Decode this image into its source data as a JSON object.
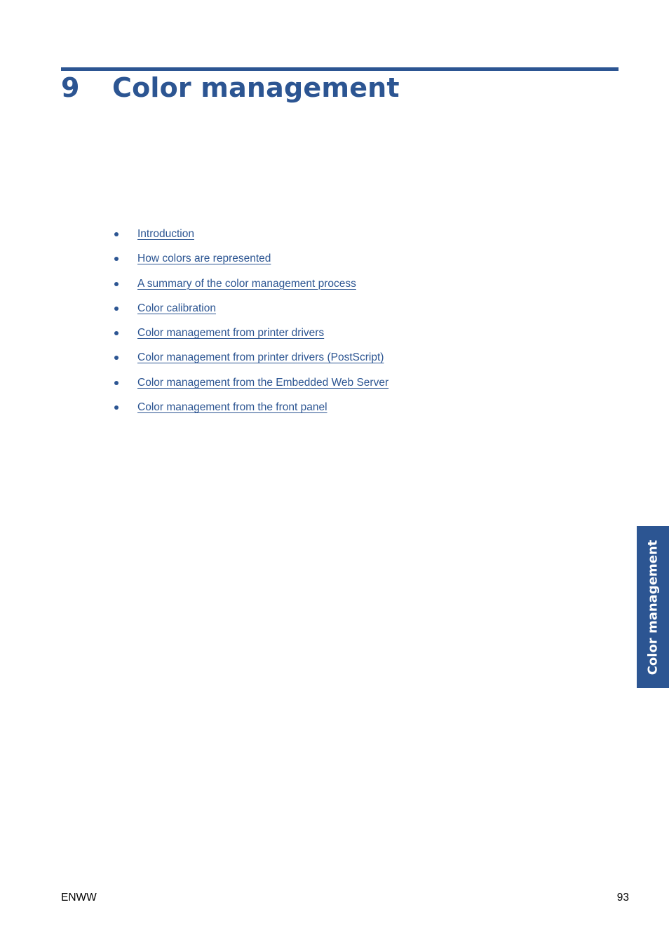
{
  "chapter": {
    "number": "9",
    "title": "Color management"
  },
  "toc": {
    "items": [
      {
        "label": "Introduction"
      },
      {
        "label": "How colors are represented"
      },
      {
        "label": "A summary of the color management process"
      },
      {
        "label": "Color calibration"
      },
      {
        "label": "Color management from printer drivers"
      },
      {
        "label": "Color management from printer drivers (PostScript)"
      },
      {
        "label": "Color management from the Embedded Web Server"
      },
      {
        "label": "Color management from the front panel"
      }
    ]
  },
  "side_tab": {
    "label": "Color management"
  },
  "footer": {
    "left": "ENWW",
    "page_number": "93"
  },
  "colors": {
    "accent": "#2c5592"
  }
}
